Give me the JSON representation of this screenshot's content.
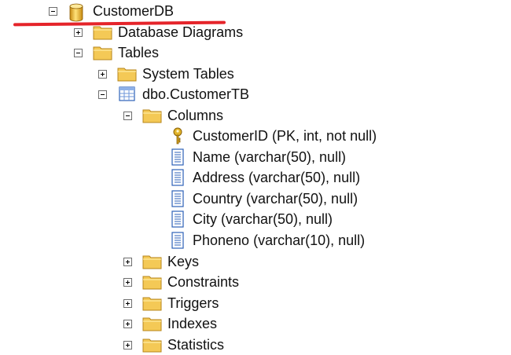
{
  "tree": {
    "root": "CustomerDB",
    "database_diagrams": "Database Diagrams",
    "tables": "Tables",
    "system_tables": "System Tables",
    "table": "dbo.CustomerTB",
    "columns": "Columns",
    "column_items": [
      "CustomerID (PK, int, not null)",
      "Name (varchar(50), null)",
      "Address (varchar(50), null)",
      "Country (varchar(50), null)",
      "City (varchar(50), null)",
      "Phoneno (varchar(10), null)"
    ],
    "keys": "Keys",
    "constraints": "Constraints",
    "triggers": "Triggers",
    "indexes": "Indexes",
    "statistics": "Statistics"
  },
  "icons": {
    "database": "database-icon",
    "folder": "folder-icon",
    "table": "table-icon",
    "key": "primary-key-icon",
    "column": "column-icon"
  },
  "colors": {
    "annotation_underline": "#e5242a",
    "folder": "#f4c956"
  }
}
